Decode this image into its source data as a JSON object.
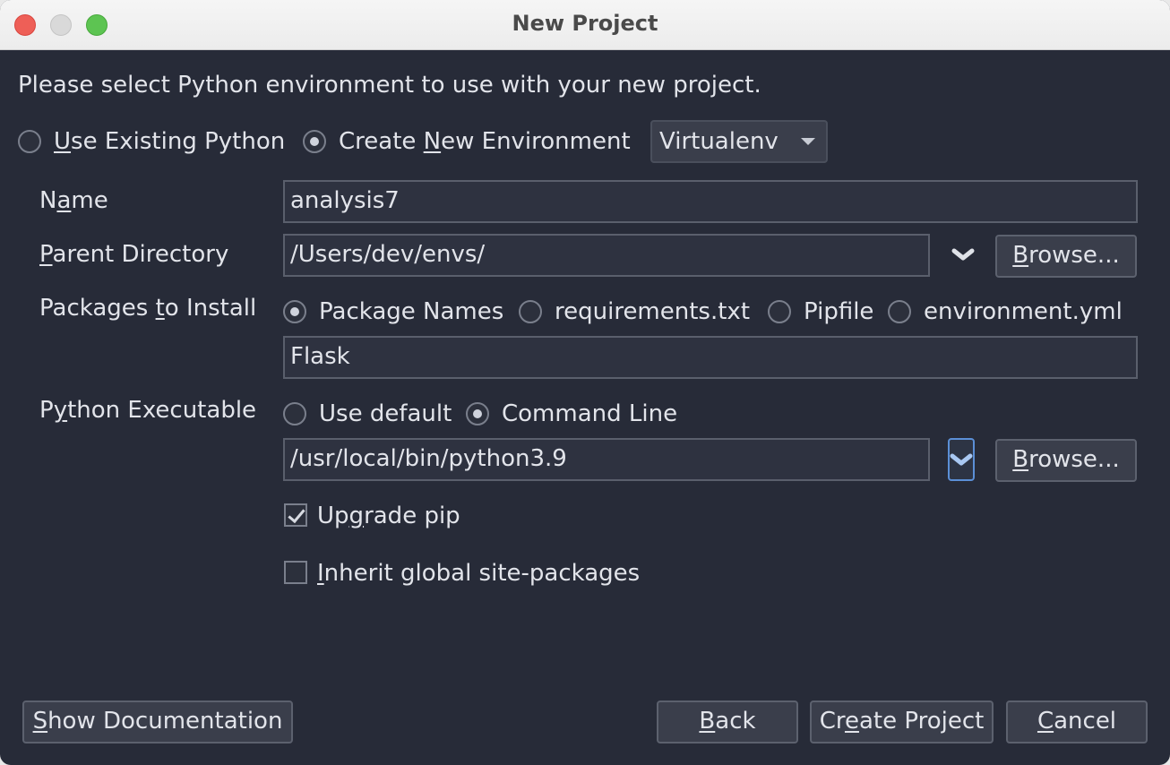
{
  "window": {
    "title": "New Project"
  },
  "intro": "Please select Python environment to use with your new project.",
  "env_choice": {
    "use_existing_pre": "",
    "use_existing_ul": "U",
    "use_existing_post": "se Existing Python",
    "create_new_pre": "Create ",
    "create_new_ul": "N",
    "create_new_post": "ew Environment",
    "selected": "create_new",
    "type_value": "Virtualenv"
  },
  "name": {
    "label_pre": "N",
    "label_ul": "a",
    "label_post": "me",
    "value": "analysis7"
  },
  "parent_dir": {
    "label_pre": "",
    "label_ul": "P",
    "label_post": "arent Directory",
    "value": "/Users/dev/envs/",
    "browse_ul": "B",
    "browse_post": "rowse..."
  },
  "packages": {
    "label_pre": "Packages ",
    "label_ul": "t",
    "label_post": "o Install",
    "options": [
      "Package Names",
      "requirements.txt",
      "Pipfile",
      "environment.yml"
    ],
    "selected_index": 0,
    "value": "Flask"
  },
  "python_exec": {
    "label_pre": "P",
    "label_ul": "y",
    "label_post": "thon Executable",
    "options": [
      "Use default",
      "Command Line"
    ],
    "selected_index": 1,
    "value": "/usr/local/bin/python3.9",
    "browse_ul": "B",
    "browse_post": "rowse..."
  },
  "upgrade_pip": {
    "pre": "Up",
    "ul": "g",
    "post": "rade pip",
    "checked": true
  },
  "inherit": {
    "pre": "",
    "ul": "I",
    "post": "nherit global site-packages",
    "checked": false
  },
  "footer": {
    "show_doc_ul": "S",
    "show_doc_post": "how Documentation",
    "back_ul": "B",
    "back_post": "ack",
    "create_pre": "Cr",
    "create_ul": "e",
    "create_post": "ate Project",
    "cancel_ul": "C",
    "cancel_post": "ancel"
  },
  "colors": {
    "background": "#272b38",
    "field_border": "#5a5f6c",
    "focus_ring": "#5b8fd6"
  }
}
